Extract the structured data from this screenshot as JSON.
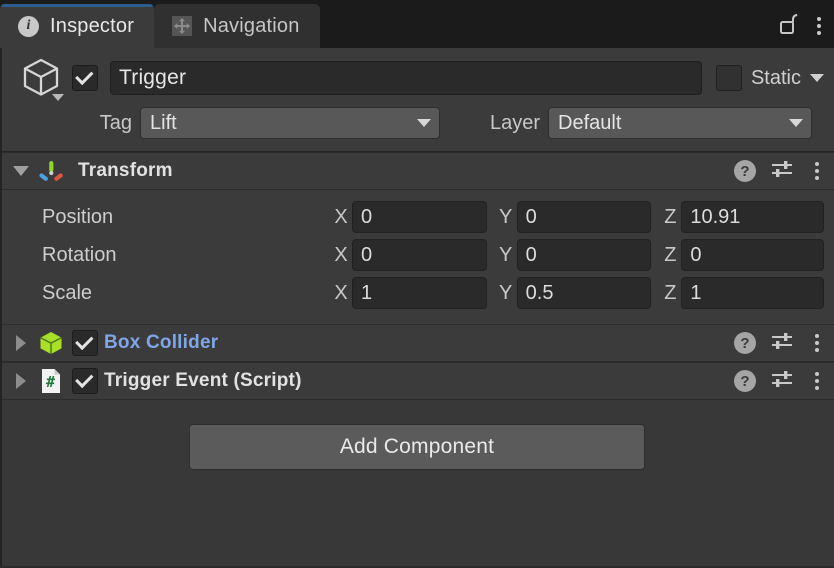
{
  "window": {
    "tabs": [
      {
        "label": "Inspector",
        "icon": "info-icon",
        "active": true
      },
      {
        "label": "Navigation",
        "icon": "navigation-move-icon",
        "active": false
      }
    ],
    "lock_icon": "unlocked-padlock-icon",
    "menu_icon": "kebab-menu-icon"
  },
  "gameobject": {
    "icon": "cube-wireframe-icon",
    "enabled": true,
    "name": "Trigger",
    "static": {
      "label": "Static",
      "checked": false
    },
    "tag": {
      "label": "Tag",
      "value": "Lift"
    },
    "layer": {
      "label": "Layer",
      "value": "Default"
    }
  },
  "components": [
    {
      "title": "Transform",
      "icon": "transform-axis-gizmo-icon",
      "expanded": true,
      "has_enable_toggle": false,
      "link_style": false,
      "rows": [
        {
          "label": "Position",
          "axes": [
            {
              "letter": "X",
              "value": "0"
            },
            {
              "letter": "Y",
              "value": "0"
            },
            {
              "letter": "Z",
              "value": "10.91"
            }
          ]
        },
        {
          "label": "Rotation",
          "axes": [
            {
              "letter": "X",
              "value": "0"
            },
            {
              "letter": "Y",
              "value": "0"
            },
            {
              "letter": "Z",
              "value": "0"
            }
          ]
        },
        {
          "label": "Scale",
          "axes": [
            {
              "letter": "X",
              "value": "1"
            },
            {
              "letter": "Y",
              "value": "0.5"
            },
            {
              "letter": "Z",
              "value": "1"
            }
          ]
        }
      ]
    },
    {
      "title": "Box Collider",
      "icon": "box-collider-green-cube-icon",
      "expanded": false,
      "has_enable_toggle": true,
      "enabled": true,
      "link_style": true
    },
    {
      "title": "Trigger Event (Script)",
      "icon": "csharp-script-icon",
      "expanded": false,
      "has_enable_toggle": true,
      "enabled": true,
      "link_style": false
    }
  ],
  "component_header_icons": {
    "help": "?",
    "help_name": "help-icon",
    "preset": "preset-settings-icon",
    "menu": "kebab-menu-icon"
  },
  "add_component": {
    "label": "Add Component"
  },
  "colors": {
    "panel_bg": "#383838",
    "header_bg": "#3b3b3b",
    "tabbar_bg": "#1b1b1b",
    "field_bg": "#2a2a2a",
    "dropdown_bg": "#585858",
    "accent_blue": "#2b5e8c",
    "link_blue": "#7fa7e8",
    "collider_green": "#a8e02a",
    "script_green": "#1e7a3c",
    "axis_green": "#8ed629",
    "axis_blue": "#4ba3e3",
    "axis_red": "#e0563d"
  }
}
